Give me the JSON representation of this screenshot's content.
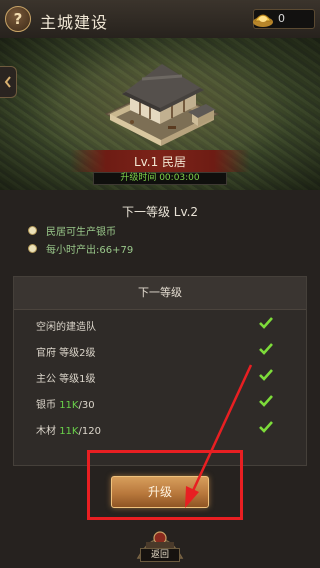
{
  "header": {
    "help_symbol": "?",
    "title": "主城建设",
    "gold_icon": "gold-ingot-icon",
    "gold_value": "0"
  },
  "scene": {
    "building_icon": "residence-building-icon",
    "level_label": "Lv.1 民居",
    "timer_text": "升级时间 00:03:00"
  },
  "next_level": {
    "title": "下一等级 Lv.2",
    "bullets": [
      "民居可生产银币",
      "每小时产出:66+79"
    ]
  },
  "requirements": {
    "header": "下一等级",
    "rows": [
      {
        "label": "空闲的建造队",
        "value": "",
        "suffix": "",
        "met": true
      },
      {
        "label": "官府 等级2级",
        "value": "",
        "suffix": "",
        "met": true
      },
      {
        "label": "主公 等级1级",
        "value": "",
        "suffix": "",
        "met": true
      },
      {
        "label": "银币 ",
        "value": "11K",
        "suffix": "/30",
        "met": true
      },
      {
        "label": "木材 ",
        "value": "11K",
        "suffix": "/120",
        "met": true
      }
    ]
  },
  "actions": {
    "upgrade_label": "升级",
    "return_label": "返回"
  },
  "colors": {
    "met_check": "#7ddc3a",
    "highlight": "#e81f22",
    "value_green": "#69d04a"
  }
}
